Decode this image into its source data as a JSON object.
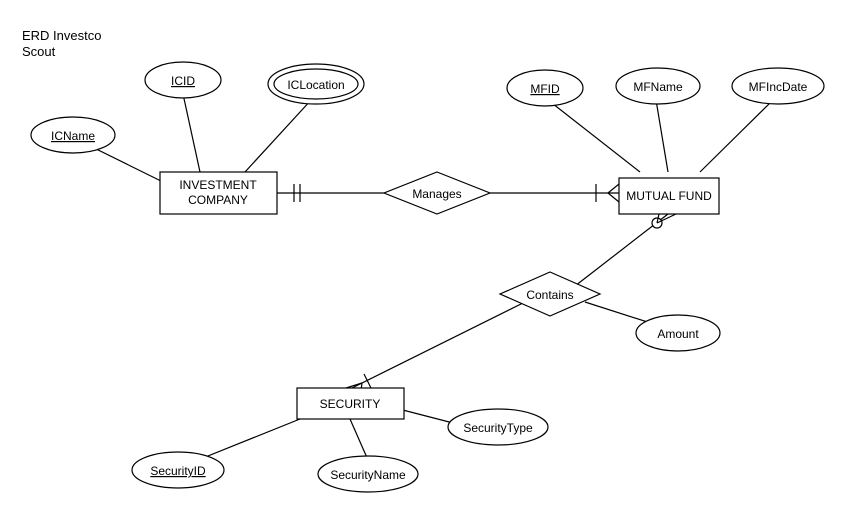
{
  "title_line1": "ERD Investco",
  "title_line2": "Scout",
  "entities": {
    "investment_company": {
      "label_line1": "INVESTMENT",
      "label_line2": "COMPANY",
      "attrs": {
        "icname": "ICName",
        "icid": "ICID",
        "iclocation": "ICLocation"
      }
    },
    "mutual_fund": {
      "label": "MUTUAL FUND",
      "attrs": {
        "mfid": "MFID",
        "mfname": "MFName",
        "mfincdate": "MFIncDate"
      }
    },
    "security": {
      "label": "SECURITY",
      "attrs": {
        "securityid": "SecurityID",
        "securityname": "SecurityName",
        "securitytype": "SecurityType"
      }
    }
  },
  "relationships": {
    "manages": "Manages",
    "contains": {
      "label": "Contains",
      "attrs": {
        "amount": "Amount"
      }
    }
  }
}
